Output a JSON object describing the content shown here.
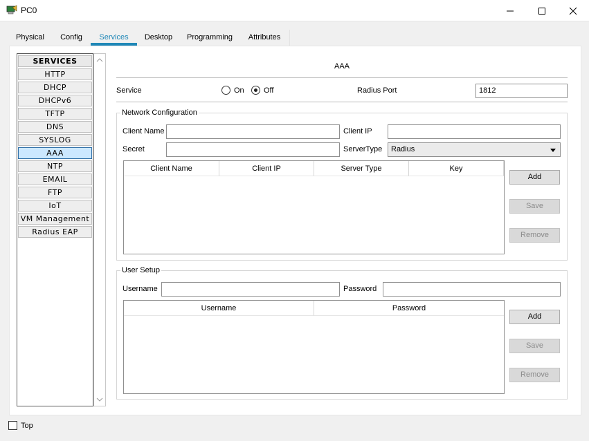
{
  "window": {
    "title": "PC0"
  },
  "tabs": [
    {
      "label": "Physical"
    },
    {
      "label": "Config"
    },
    {
      "label": "Services"
    },
    {
      "label": "Desktop"
    },
    {
      "label": "Programming"
    },
    {
      "label": "Attributes"
    }
  ],
  "active_tab": "Services",
  "sidebar": {
    "header": "SERVICES",
    "items": [
      "HTTP",
      "DHCP",
      "DHCPv6",
      "TFTP",
      "DNS",
      "SYSLOG",
      "AAA",
      "NTP",
      "EMAIL",
      "FTP",
      "IoT",
      "VM Management",
      "Radius EAP"
    ],
    "selected": "AAA"
  },
  "aaa": {
    "title": "AAA",
    "service_label": "Service",
    "on_label": "On",
    "off_label": "Off",
    "service_state": "Off",
    "radius_port_label": "Radius Port",
    "radius_port_value": "1812"
  },
  "network_config": {
    "legend": "Network Configuration",
    "client_name_label": "Client Name",
    "client_name_value": "",
    "client_ip_label": "Client IP",
    "client_ip_value": "",
    "secret_label": "Secret",
    "secret_value": "",
    "server_type_label": "ServerType",
    "server_type_value": "Radius",
    "columns": [
      "Client Name",
      "Client IP",
      "Server Type",
      "Key"
    ],
    "rows": [],
    "add_label": "Add",
    "save_label": "Save",
    "remove_label": "Remove"
  },
  "user_setup": {
    "legend": "User Setup",
    "username_label": "Username",
    "username_value": "",
    "password_label": "Password",
    "password_value": "",
    "columns": [
      "Username",
      "Password"
    ],
    "rows": [],
    "add_label": "Add",
    "save_label": "Save",
    "remove_label": "Remove"
  },
  "footer": {
    "top_label": "Top",
    "top_checked": false
  },
  "colors": {
    "accent": "#1f87b7",
    "selected_bg": "#cce8ff"
  }
}
